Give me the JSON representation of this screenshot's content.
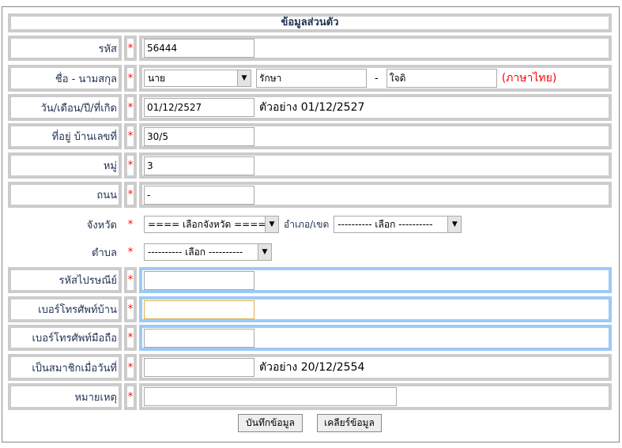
{
  "title": "ข้อมูลส่วนตัว",
  "required_mark": "*",
  "fields": {
    "code": {
      "label": "รหัส",
      "value": "56444"
    },
    "name": {
      "label": "ชื่อ - นามสกุล",
      "prefix": "นาย",
      "first": "รักษา",
      "sep": "-",
      "last": "ใจดิ",
      "note": "(ภาษาไทย)"
    },
    "dob": {
      "label": "วัน/เดือน/ปี/ที่เกิด",
      "value": "01/12/2527",
      "example": "ตัวอย่าง 01/12/2527"
    },
    "house": {
      "label": "ที่อยู่ บ้านเลขที่",
      "value": "30/5"
    },
    "moo": {
      "label": "หมู่",
      "value": "3"
    },
    "road": {
      "label": "ถนน",
      "value": "-"
    },
    "province": {
      "label": "จังหวัด",
      "value": "==== เลือกจังหวัด ===="
    },
    "district": {
      "label": "อำเภอ/เขต",
      "value": "---------- เลือก ----------"
    },
    "subdistrict": {
      "label": "ตำบล",
      "value": "---------- เลือก ----------"
    },
    "postcode": {
      "label": "รหัสไปรษณีย์",
      "value": ""
    },
    "home_phone": {
      "label": "เบอร์โทรศัพท์บ้าน",
      "value": ""
    },
    "mobile": {
      "label": "เบอร์โทรศัพท์มือถือ",
      "value": ""
    },
    "member_since": {
      "label": "เป็นสมาชิกเมื่อวันที่",
      "value": "",
      "example": "ตัวอย่าง 20/12/2554"
    },
    "remark": {
      "label": "หมายเหตุ",
      "value": ""
    }
  },
  "buttons": {
    "save": "บันทึกข้อมูล",
    "clear": "เคลียร์ข้อมูล"
  }
}
